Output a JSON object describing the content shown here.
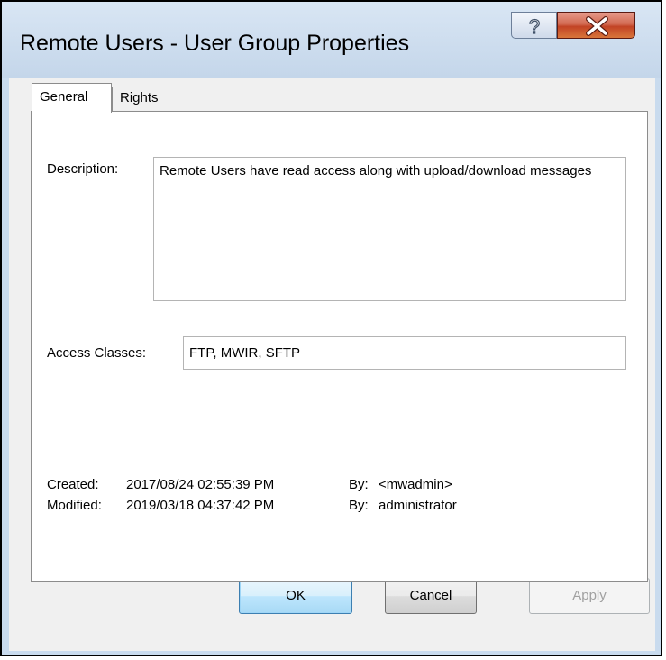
{
  "window": {
    "title": "Remote Users - User Group Properties",
    "help_icon": "question-mark-icon",
    "close_icon": "close-x-icon",
    "accent_close": "#c74a2a"
  },
  "tabs": [
    {
      "label": "General",
      "selected": true
    },
    {
      "label": "Rights",
      "selected": false
    }
  ],
  "general": {
    "description_label": "Description:",
    "description_value": "Remote Users have read access along with upload/download messages",
    "access_classes_label": "Access Classes:",
    "access_classes_value": "FTP, MWIR, SFTP",
    "created_label": "Created:",
    "created_value": "2017/08/24  02:55:39 PM",
    "created_by_label": "By:",
    "created_by_value": "<mwadmin>",
    "modified_label": "Modified:",
    "modified_value": "2019/03/18  04:37:42 PM",
    "modified_by_label": "By:",
    "modified_by_value": "administrator"
  },
  "buttons": {
    "ok": "OK",
    "cancel": "Cancel",
    "apply": "Apply"
  }
}
